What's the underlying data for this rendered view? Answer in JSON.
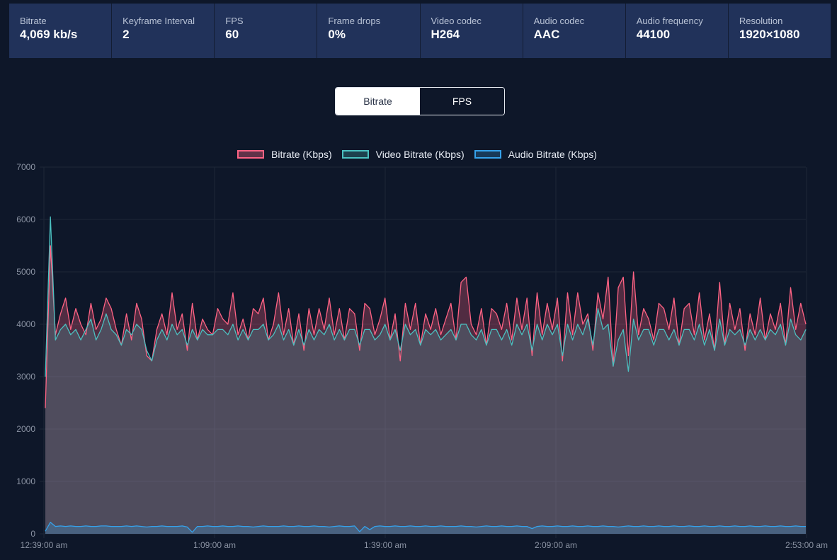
{
  "stats": [
    {
      "label": "Bitrate",
      "value": "4,069 kb/s"
    },
    {
      "label": "Keyframe Interval",
      "value": "2"
    },
    {
      "label": "FPS",
      "value": "60"
    },
    {
      "label": "Frame drops",
      "value": "0%"
    },
    {
      "label": "Video codec",
      "value": "H264"
    },
    {
      "label": "Audio codec",
      "value": "AAC"
    },
    {
      "label": "Audio frequency",
      "value": "44100"
    },
    {
      "label": "Resolution",
      "value": "1920×1080"
    }
  ],
  "toggle": {
    "bitrate_label": "Bitrate",
    "fps_label": "FPS",
    "active": "Bitrate"
  },
  "colors": {
    "bitrate": "#ff6384",
    "video": "#4bc0c0",
    "audio": "#36a2eb",
    "background": "#0e1729",
    "stat_bg": "#21325a"
  },
  "chart_data": {
    "type": "area",
    "x_ticks": [
      "12:39:00 am",
      "1:09:00 am",
      "1:39:00 am",
      "2:09:00 am",
      "2:53:00 am"
    ],
    "y_ticks": [
      0,
      1000,
      2000,
      3000,
      4000,
      5000,
      6000,
      7000
    ],
    "ylim": [
      0,
      7000
    ],
    "grid": true,
    "legend_position": "top",
    "series": [
      {
        "name": "Bitrate (Kbps)",
        "color": "#ff6384",
        "values": [
          2400,
          5500,
          3800,
          4200,
          4500,
          3900,
          4300,
          4000,
          3800,
          4400,
          3900,
          4100,
          4500,
          4300,
          3900,
          3600,
          4200,
          3700,
          4400,
          4100,
          3400,
          3300,
          3900,
          4200,
          3800,
          4600,
          3900,
          4200,
          3500,
          4400,
          3700,
          4100,
          3900,
          3800,
          4300,
          4100,
          4000,
          4600,
          3800,
          4100,
          3700,
          4300,
          4200,
          4500,
          3700,
          4000,
          4600,
          3800,
          4300,
          3600,
          4200,
          3500,
          4300,
          3800,
          4300,
          3900,
          4500,
          3800,
          4300,
          3700,
          4300,
          4200,
          3500,
          4400,
          4300,
          3800,
          4100,
          4500,
          3700,
          4200,
          3300,
          4400,
          3900,
          4400,
          3600,
          4200,
          3900,
          4300,
          3800,
          4100,
          4400,
          3700,
          4800,
          4900,
          4000,
          3800,
          4300,
          3600,
          4300,
          4200,
          3900,
          4400,
          3700,
          4500,
          3900,
          4500,
          3400,
          4600,
          3800,
          4400,
          3900,
          4500,
          3300,
          4600,
          3800,
          4600,
          4000,
          4200,
          3500,
          4600,
          4100,
          4900,
          3200,
          4700,
          4900,
          3400,
          5000,
          3800,
          4300,
          4100,
          3700,
          4400,
          4300,
          3900,
          4500,
          3600,
          4300,
          4400,
          3800,
          4600,
          3700,
          4200,
          3500,
          4800,
          3600,
          4400,
          3900,
          4300,
          3500,
          4200,
          3800,
          4500,
          3700,
          4200,
          3900,
          4400,
          3600,
          4700,
          3900,
          4400,
          4000
        ]
      },
      {
        "name": "Video Bitrate (Kbps)",
        "color": "#4bc0c0",
        "values": [
          3000,
          6050,
          3700,
          3900,
          4000,
          3800,
          3900,
          3700,
          3900,
          4100,
          3700,
          3900,
          4200,
          3900,
          3800,
          3600,
          3900,
          3800,
          4000,
          3900,
          3500,
          3300,
          3700,
          3900,
          3700,
          4000,
          3800,
          3900,
          3600,
          3900,
          3700,
          3900,
          3800,
          3800,
          3900,
          3900,
          3800,
          4000,
          3700,
          3900,
          3700,
          3900,
          3900,
          4000,
          3700,
          3800,
          4000,
          3700,
          3900,
          3600,
          3900,
          3600,
          3900,
          3700,
          3900,
          3800,
          4000,
          3700,
          3900,
          3700,
          3900,
          3900,
          3600,
          3900,
          3900,
          3700,
          3800,
          4000,
          3700,
          3900,
          3500,
          4000,
          3800,
          3900,
          3600,
          3900,
          3800,
          3900,
          3700,
          3800,
          3900,
          3700,
          4000,
          4000,
          3800,
          3700,
          3900,
          3600,
          3900,
          3900,
          3700,
          3900,
          3600,
          4000,
          3800,
          4000,
          3500,
          4000,
          3700,
          4000,
          3800,
          4000,
          3400,
          4000,
          3700,
          4000,
          3800,
          4100,
          3600,
          4300,
          3900,
          4000,
          3200,
          3700,
          3900,
          3100,
          4100,
          3700,
          3900,
          3900,
          3600,
          3900,
          3900,
          3700,
          3900,
          3600,
          3900,
          3900,
          3700,
          4000,
          3600,
          3900,
          3500,
          4100,
          3600,
          3900,
          3800,
          3900,
          3600,
          3900,
          3700,
          3900,
          3700,
          3900,
          3800,
          4000,
          3600,
          4100,
          3800,
          3700,
          3900
        ]
      },
      {
        "name": "Audio Bitrate (Kbps)",
        "color": "#36a2eb",
        "values": [
          50,
          220,
          140,
          150,
          140,
          150,
          140,
          140,
          150,
          140,
          140,
          150,
          150,
          140,
          140,
          140,
          150,
          140,
          150,
          140,
          130,
          140,
          140,
          150,
          140,
          140,
          140,
          150,
          130,
          30,
          140,
          140,
          150,
          140,
          140,
          150,
          140,
          140,
          150,
          140,
          140,
          130,
          140,
          150,
          140,
          140,
          140,
          150,
          140,
          140,
          150,
          140,
          140,
          150,
          140,
          140,
          130,
          140,
          150,
          140,
          140,
          150,
          40,
          140,
          80,
          140,
          150,
          140,
          140,
          150,
          140,
          140,
          150,
          140,
          140,
          150,
          140,
          140,
          150,
          140,
          140,
          140,
          150,
          140,
          140,
          130,
          140,
          150,
          140,
          140,
          150,
          140,
          140,
          150,
          140,
          140,
          100,
          140,
          150,
          140,
          140,
          150,
          140,
          140,
          150,
          140,
          140,
          150,
          140,
          140,
          150,
          140,
          140,
          130,
          140,
          150,
          140,
          140,
          150,
          140,
          140,
          150,
          140,
          140,
          150,
          140,
          140,
          150,
          140,
          140,
          150,
          140,
          140,
          150,
          140,
          140,
          150,
          140,
          140,
          150,
          140,
          140,
          150,
          140,
          140,
          150,
          140,
          140,
          150,
          140,
          140
        ]
      }
    ]
  }
}
